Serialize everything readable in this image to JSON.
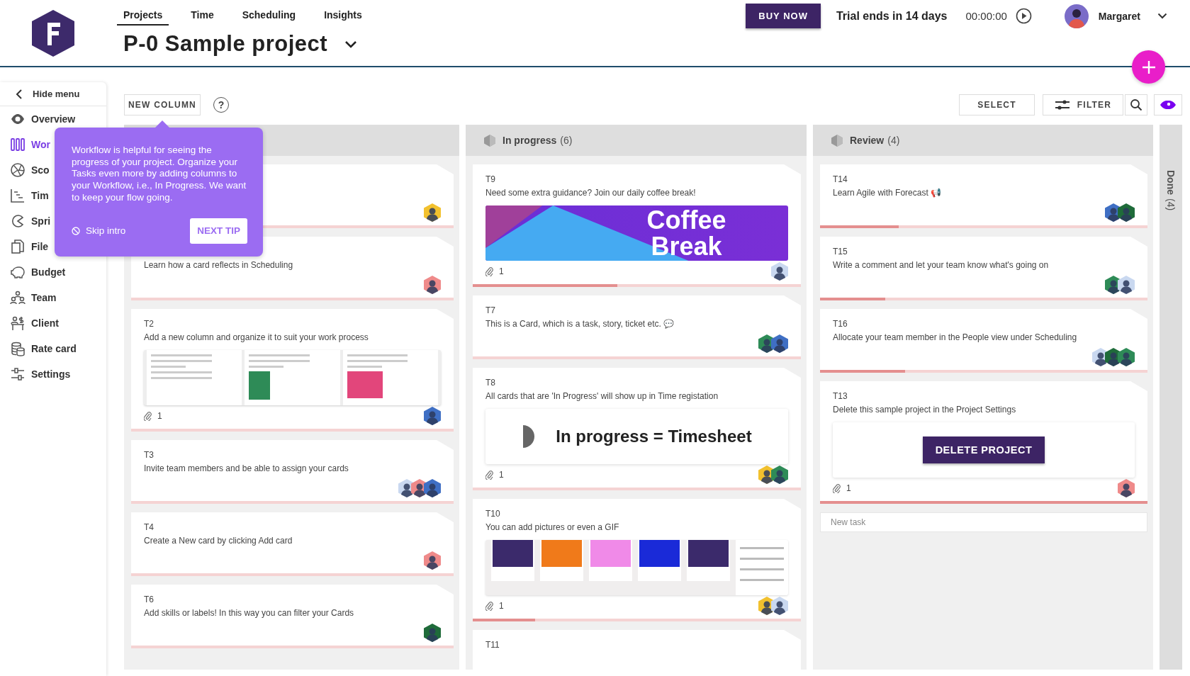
{
  "header": {
    "nav": [
      {
        "label": "Projects",
        "selected": true
      },
      {
        "label": "Time",
        "selected": false
      },
      {
        "label": "Scheduling",
        "selected": false
      },
      {
        "label": "Insights",
        "selected": false
      }
    ],
    "project_title": "P-0 Sample project",
    "buy_button": "BUY NOW",
    "trial": "Trial ends in 14 days",
    "timer": "00:00:00",
    "user": "Margaret"
  },
  "sidebar": {
    "hide_menu": "Hide menu",
    "items": [
      {
        "label": "Overview",
        "selected": false
      },
      {
        "label": "Wor",
        "selected": true
      },
      {
        "label": "Sco",
        "selected": false
      },
      {
        "label": "Tim",
        "selected": false
      },
      {
        "label": "Spri",
        "selected": false
      },
      {
        "label": "File",
        "selected": false
      },
      {
        "label": "Budget",
        "selected": false
      },
      {
        "label": "Team",
        "selected": false
      },
      {
        "label": "Client",
        "selected": false
      },
      {
        "label": "Rate card",
        "selected": false
      },
      {
        "label": "Settings",
        "selected": false
      }
    ]
  },
  "toolbar": {
    "new_column": "NEW COLUMN",
    "help": "?",
    "select": "SELECT",
    "filter": "FILTER"
  },
  "tip": {
    "text": "Workflow is helpful for seeing the progress of your project. Organize your Tasks even more by adding columns to your Workflow, i.e., In Progress. We want to keep your flow going.",
    "skip": "Skip intro",
    "next": "NEXT TIP"
  },
  "columns": [
    {
      "cards": [
        {
          "avatars": [
            {
              "color": "#f2c12e"
            }
          ],
          "level": 0
        },
        {
          "title": "Learn how a card reflects in Scheduling",
          "avatars": [
            {
              "color": "#ef8a8a"
            }
          ],
          "level": 0
        },
        {
          "id": "T2",
          "title": "Add a new column and organize it to suit your work process",
          "image": {
            "kind": "screens"
          },
          "attachments": "1",
          "avatars": [
            {
              "color": "#3f6fc4"
            }
          ],
          "level": 0
        },
        {
          "id": "T3",
          "title": "Invite team members and be able to assign your cards",
          "avatars": [
            {
              "color": "#c9d8f0"
            },
            {
              "color": "#ef8a8a"
            },
            {
              "color": "#3f6fc4"
            }
          ],
          "level": 0
        },
        {
          "id": "T4",
          "title": "Create a New card by clicking Add card",
          "avatars": [
            {
              "color": "#ef8a8a"
            }
          ],
          "level": 0
        },
        {
          "id": "T6",
          "title": "Add skills or labels! In this way you can filter your Cards",
          "avatars": [
            {
              "color": "#1f6b3a"
            }
          ],
          "level": 0
        }
      ]
    },
    {
      "name": "In progress",
      "count": "(6)",
      "cards": [
        {
          "id": "T9",
          "title": "Need some extra guidance? Join our daily coffee break!",
          "image": {
            "kind": "banner",
            "lines": [
              "Coffee",
              "Break"
            ]
          },
          "attachments": "1",
          "avatars": [
            {
              "color": "#c9d8f0"
            }
          ],
          "level": 0.44
        },
        {
          "id": "T7",
          "title": "This is a Card, which is a task, story, ticket etc. 💬",
          "avatars": [
            {
              "color": "#2e8b57"
            },
            {
              "color": "#3f6fc4"
            }
          ],
          "level": 0
        },
        {
          "id": "T8",
          "title": "All cards that are 'In Progress' will show up in Time registation",
          "image": {
            "kind": "timesheet",
            "text": "In progress = Timesheet"
          },
          "attachments": "1",
          "avatars": [
            {
              "color": "#f2c12e"
            },
            {
              "color": "#2e8b57"
            }
          ],
          "level": 0
        },
        {
          "id": "T10",
          "title": "You can add pictures or even a GIF",
          "image": {
            "kind": "slides"
          },
          "attachments": "1",
          "avatars": [
            {
              "color": "#f2c12e"
            },
            {
              "color": "#c9d8f0"
            }
          ],
          "level": 0.19
        },
        {
          "id": "T11"
        }
      ]
    },
    {
      "name": "Review",
      "count": "(4)",
      "cards": [
        {
          "id": "T14",
          "title": "Learn Agile with Forecast 📢",
          "avatars": [
            {
              "color": "#3f6fc4"
            },
            {
              "color": "#1f6b3a"
            }
          ],
          "level": 0.24
        },
        {
          "id": "T15",
          "title": "Write a comment and let your team know what's going on",
          "avatars": [
            {
              "color": "#2e8b57"
            },
            {
              "color": "#c9d8f0"
            }
          ],
          "level": 0.2
        },
        {
          "id": "T16",
          "title": "Allocate your team member in the People view under Scheduling",
          "avatars": [
            {
              "color": "#c9d8f0"
            },
            {
              "color": "#1f6b3a"
            },
            {
              "color": "#2e8b57"
            }
          ],
          "level": 0.26
        },
        {
          "id": "T13",
          "title": "Delete this sample project in the Project Settings",
          "image": {
            "kind": "delete",
            "text": "DELETE PROJECT"
          },
          "attachments": "1",
          "avatars": [
            {
              "color": "#ef8a8a"
            }
          ],
          "level": 1
        }
      ],
      "new_task": {
        "placeholder": "New task"
      }
    }
  ],
  "done_column": {
    "name": "Done",
    "count": "(4)"
  }
}
